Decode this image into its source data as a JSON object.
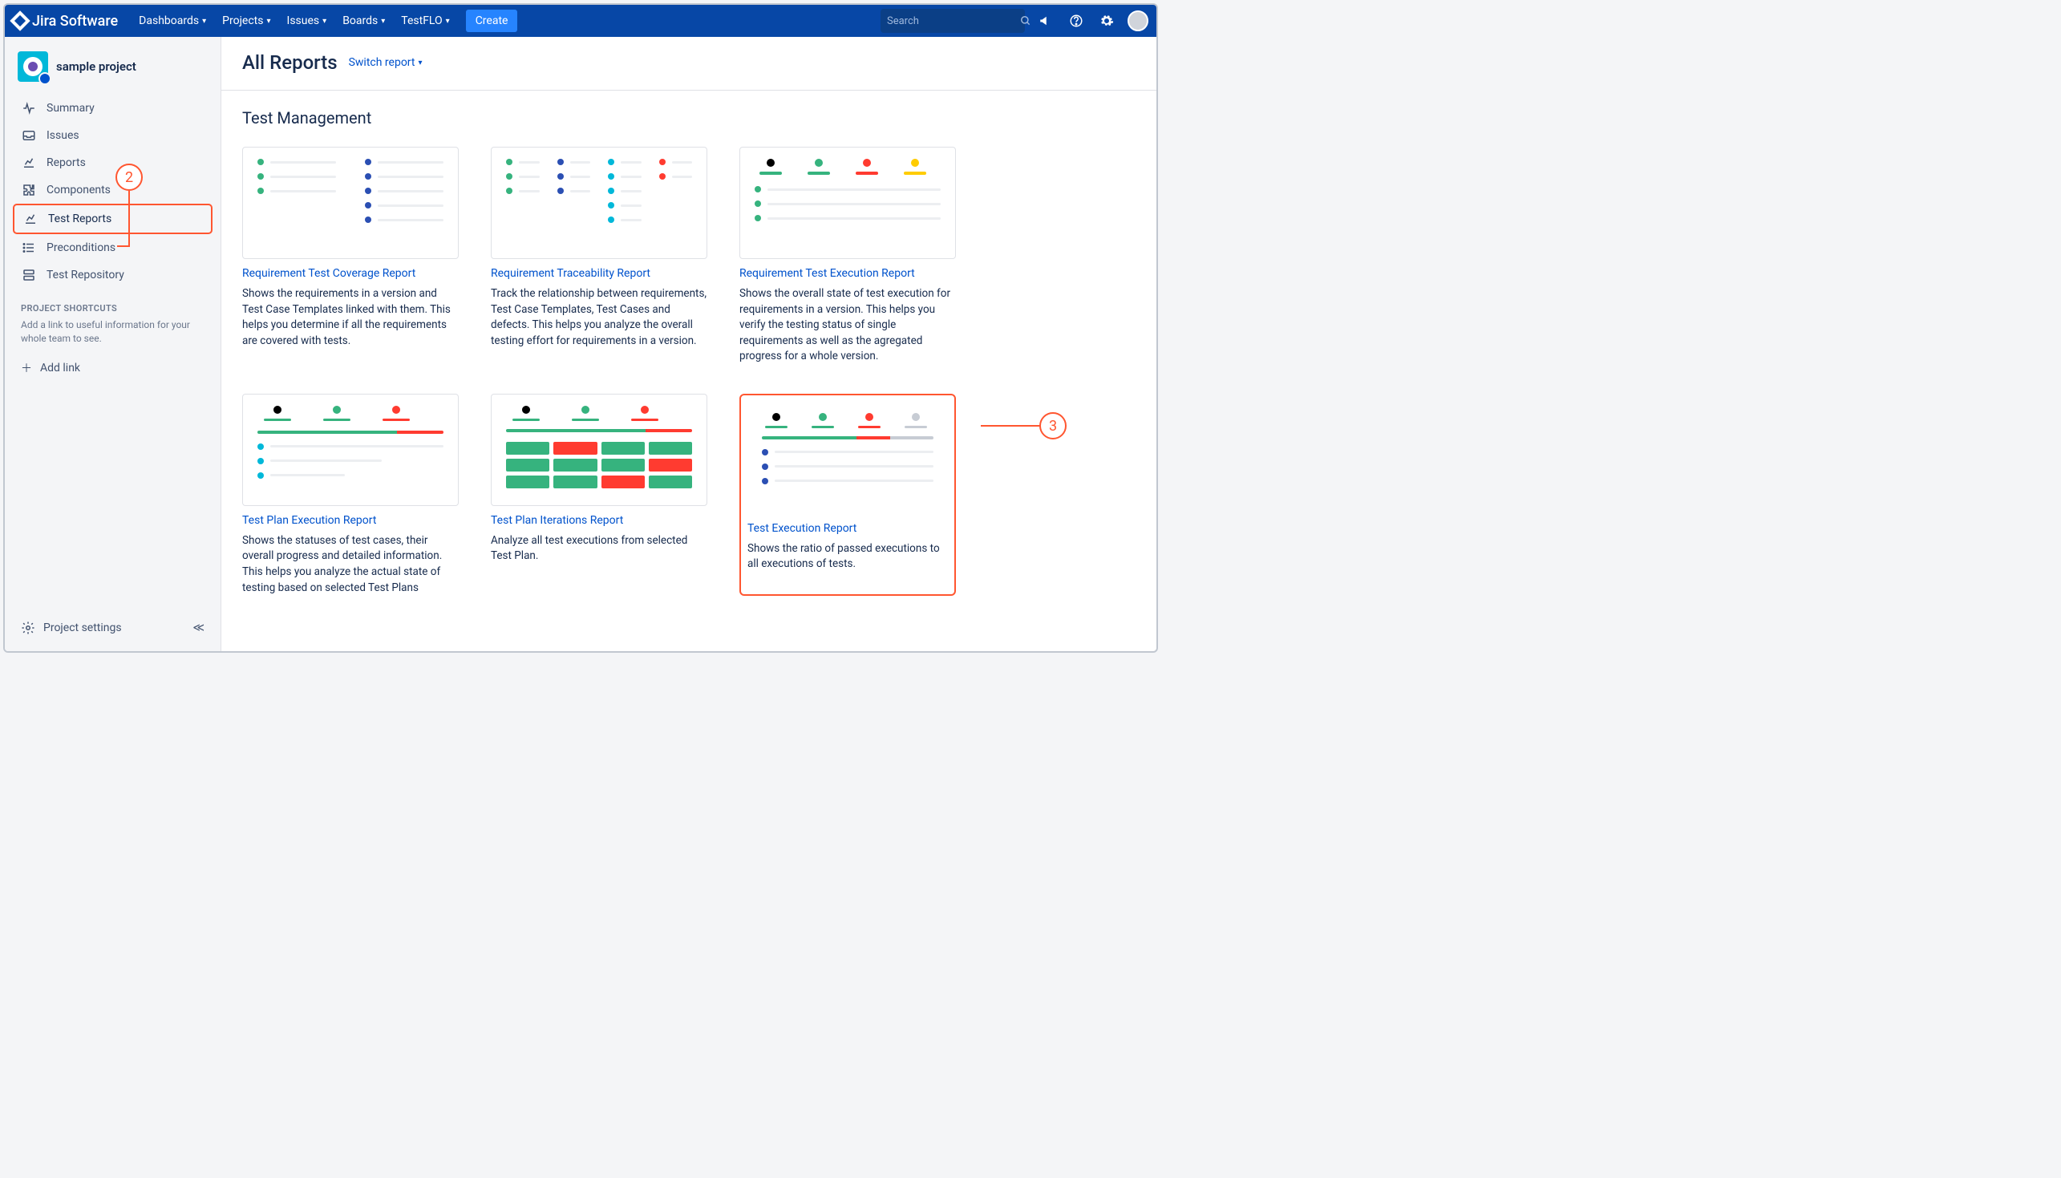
{
  "nav": {
    "logo": "Jira Software",
    "items": [
      "Dashboards",
      "Projects",
      "Issues",
      "Boards",
      "TestFLO"
    ],
    "create": "Create",
    "search_placeholder": "Search"
  },
  "sidebar": {
    "project": "sample project",
    "items": [
      {
        "icon": "pulse",
        "label": "Summary"
      },
      {
        "icon": "tray",
        "label": "Issues"
      },
      {
        "icon": "chart",
        "label": "Reports"
      },
      {
        "icon": "puzzle",
        "label": "Components"
      },
      {
        "icon": "chart",
        "label": "Test Reports"
      },
      {
        "icon": "list",
        "label": "Preconditions"
      },
      {
        "icon": "folder",
        "label": "Test Repository"
      }
    ],
    "shortcuts_head": "PROJECT SHORTCUTS",
    "shortcuts_text": "Add a link to useful information for your whole team to see.",
    "add_link": "Add link",
    "settings": "Project settings"
  },
  "main": {
    "title": "All Reports",
    "switch": "Switch report",
    "section": "Test Management",
    "cards": [
      {
        "title": "Requirement Test Coverage Report",
        "desc": "Shows the requirements in a version and Test Case Templates linked with them. This helps you determine if all the requirements are covered with tests."
      },
      {
        "title": "Requirement Traceability Report",
        "desc": "Track the relationship between requirements, Test Case Templates, Test Cases and defects. This helps you analyze the overall testing effort for requirements in a version."
      },
      {
        "title": "Requirement Test Execution Report",
        "desc": "Shows the overall state of test execution for requirements in a version. This helps you verify the testing status of single requirements as well as the agregated progress for a whole version."
      },
      {
        "title": "Test Plan Execution Report",
        "desc": "Shows the statuses of test cases, their overall progress and detailed information. This helps you analyze the actual state of testing based on selected Test Plans"
      },
      {
        "title": "Test Plan Iterations Report",
        "desc": "Analyze all test executions from selected Test Plan."
      },
      {
        "title": "Test Execution Report",
        "desc": "Shows the ratio of passed executions to all executions of tests."
      }
    ]
  },
  "callouts": {
    "c2": "2",
    "c3": "3"
  }
}
